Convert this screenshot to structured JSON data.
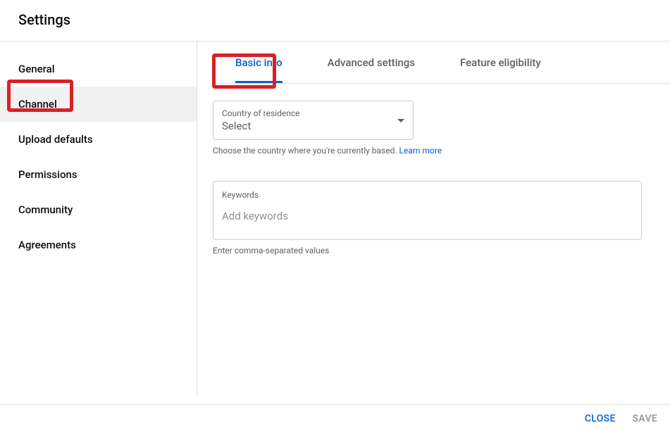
{
  "header": {
    "title": "Settings"
  },
  "sidebar": {
    "items": [
      {
        "label": "General"
      },
      {
        "label": "Channel"
      },
      {
        "label": "Upload defaults"
      },
      {
        "label": "Permissions"
      },
      {
        "label": "Community"
      },
      {
        "label": "Agreements"
      }
    ]
  },
  "tabs": {
    "items": [
      {
        "label": "Basic info"
      },
      {
        "label": "Advanced settings"
      },
      {
        "label": "Feature eligibility"
      }
    ]
  },
  "country": {
    "label": "Country of residence",
    "value": "Select",
    "helper": "Choose the country where you're currently based. ",
    "learnMore": "Learn more"
  },
  "keywords": {
    "label": "Keywords",
    "placeholder": "Add keywords",
    "helper": "Enter comma-separated values"
  },
  "footer": {
    "close": "CLOSE",
    "save": "SAVE"
  }
}
